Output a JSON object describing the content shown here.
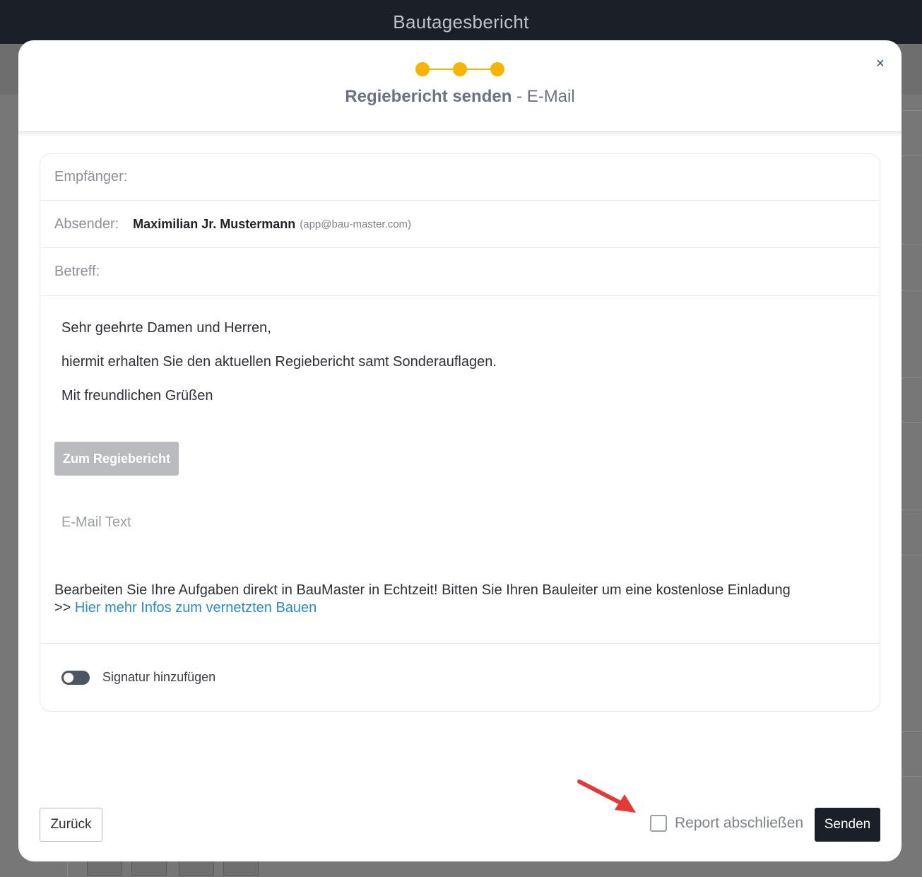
{
  "app": {
    "title": "Bautagesbericht"
  },
  "modal": {
    "title_bold": "Regiebericht senden",
    "title_rest": " - E-Mail",
    "close_glyph": "×",
    "steps": 3
  },
  "form": {
    "recipient_label": "Empfänger:",
    "sender_label": "Absender:",
    "sender_name": "Maximilian Jr. Mustermann",
    "sender_email": "(app@bau-master.com)",
    "subject_label": "Betreff:"
  },
  "body": {
    "greeting": "Sehr geehrte Damen und Herren,",
    "message": "hiermit erhalten Sie den aktuellen Regiebericht samt Sonderauflagen.",
    "closing": "Mit freundlichen Grüßen",
    "report_button": "Zum Regiebericht",
    "email_text_placeholder": "E-Mail Text",
    "promo_text": "Bearbeiten Sie Ihre Aufgaben direkt in BauMaster in Echtzeit! Bitten Sie Ihren Bauleiter um eine kostenlose Einladung",
    "promo_prefix": ">> ",
    "promo_link": "Hier mehr Infos zum vernetzten Bauen"
  },
  "signature": {
    "label": "Signatur hinzufügen",
    "enabled": false
  },
  "footer": {
    "back_label": "Zurück",
    "finish_label": "Report abschließen",
    "finish_checked": false,
    "send_label": "Senden"
  },
  "colors": {
    "accent": "#f5b400",
    "dark": "#1b1f27",
    "link": "#2a8bc7",
    "annotation_arrow": "#e53935"
  }
}
